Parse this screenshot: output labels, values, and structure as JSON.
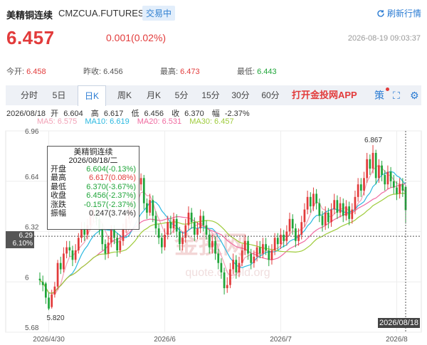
{
  "header": {
    "title_cn": "美精铜连续",
    "code": "CMZCUA.FUTURES",
    "badge": "交易中",
    "refresh_label": "刷新行情"
  },
  "quote": {
    "price": "6.457",
    "change": "0.001(0.02%)",
    "datetime": "2026-08-19 09:03:37"
  },
  "stats": [
    {
      "label": "今开:",
      "value": "6.458",
      "color": "red"
    },
    {
      "label": "昨收:",
      "value": "6.456",
      "color": "neutral"
    },
    {
      "label": "最高:",
      "value": "6.473",
      "color": "red"
    },
    {
      "label": "最低:",
      "value": "6.443",
      "color": "green"
    }
  ],
  "tabs": [
    "分时",
    "5日",
    "日K",
    "周K",
    "月K",
    "5分",
    "15分",
    "30分",
    "60分"
  ],
  "active_tab": "日K",
  "app_link": "打开金投网APP",
  "toolbar_icons": [
    "strategy-icon",
    "fullscreen-icon",
    "settings-icon"
  ],
  "toolbar_glyphs": {
    "strategy": "策",
    "fullscreen": "⛶",
    "settings": "⚙"
  },
  "ohlc": {
    "date": "2026/08/18",
    "open_label": "开",
    "open": "6.604",
    "high_label": "高",
    "high": "6.617",
    "low_label": "低",
    "low": "6.456",
    "close_label": "收",
    "close": "6.370",
    "amp_label": "幅",
    "amp": "-2.37%"
  },
  "ma": [
    {
      "label": "MA5: 6.575",
      "color": "#f2a1b6"
    },
    {
      "label": "MA10: 6.619",
      "color": "#2ab8e0"
    },
    {
      "label": "MA20: 6.531",
      "color": "#f06aa0"
    },
    {
      "label": "MA30: 6.457",
      "color": "#9ecb3a"
    }
  ],
  "tooltip": {
    "title": "美精铜连续",
    "date": "2026/08/18/二",
    "rows": [
      {
        "k": "开盘",
        "v": "6.604(-0.13%)",
        "c": "green"
      },
      {
        "k": "最高",
        "v": "6.617(0.08%)",
        "c": "red"
      },
      {
        "k": "最低",
        "v": "6.370(-3.67%)",
        "c": "green"
      },
      {
        "k": "收盘",
        "v": "6.456(-2.37%)",
        "c": "green"
      },
      {
        "k": "涨跌",
        "v": "-0.157(-2.37%)",
        "c": "green"
      },
      {
        "k": "振幅",
        "v": "0.247(3.74%)",
        "c": "neutral"
      }
    ]
  },
  "crosshair": {
    "price": "6.29",
    "pct": "6.10%",
    "date": "2026/08/18"
  },
  "watermark": {
    "cn": "金投网",
    "en": "quote.cngold.org"
  },
  "colors": {
    "up": "#e23b3b",
    "down": "#1fa539",
    "accent": "#2b7cd3"
  },
  "chart_data": {
    "type": "candlestick",
    "y_ticks": [
      6.96,
      6.64,
      6.32,
      6.0,
      5.68
    ],
    "y_tick_labels": [
      "6.96",
      "6.64",
      "6.32",
      "6",
      "5.68"
    ],
    "ylim": [
      5.68,
      6.96
    ],
    "x_tick_labels": [
      "2026/4/30",
      "2026/6",
      "2026/7",
      "2026/8"
    ],
    "x_tick_index": [
      3,
      42,
      81,
      120
    ],
    "max_label": "6.867",
    "min_label": "5.820",
    "grid": true,
    "candles": [
      [
        6.02,
        6.01,
        6.06,
        5.98
      ],
      [
        6.0,
        5.98,
        6.04,
        5.94
      ],
      [
        5.99,
        5.9,
        6.0,
        5.86
      ],
      [
        5.9,
        5.83,
        5.93,
        5.82
      ],
      [
        5.84,
        5.92,
        5.95,
        5.83
      ],
      [
        5.92,
        5.97,
        6.0,
        5.9
      ],
      [
        5.97,
        6.12,
        6.14,
        5.95
      ],
      [
        6.12,
        6.08,
        6.16,
        6.05
      ],
      [
        6.08,
        6.18,
        6.22,
        6.06
      ],
      [
        6.18,
        6.22,
        6.26,
        6.15
      ],
      [
        6.22,
        6.2,
        6.26,
        6.16
      ],
      [
        6.2,
        6.14,
        6.23,
        6.1
      ],
      [
        6.14,
        6.2,
        6.24,
        6.12
      ],
      [
        6.2,
        6.28,
        6.31,
        6.18
      ],
      [
        6.28,
        6.34,
        6.38,
        6.25
      ],
      [
        6.34,
        6.3,
        6.38,
        6.26
      ],
      [
        6.3,
        6.36,
        6.4,
        6.27
      ],
      [
        6.36,
        6.42,
        6.46,
        6.33
      ],
      [
        6.42,
        6.46,
        6.5,
        6.38
      ],
      [
        6.46,
        6.4,
        6.49,
        6.36
      ],
      [
        6.4,
        6.34,
        6.43,
        6.3
      ],
      [
        6.34,
        6.24,
        6.37,
        6.2
      ],
      [
        6.24,
        6.18,
        6.27,
        6.14
      ],
      [
        6.18,
        6.25,
        6.29,
        6.15
      ],
      [
        6.25,
        6.33,
        6.36,
        6.22
      ],
      [
        6.33,
        6.28,
        6.36,
        6.24
      ],
      [
        6.28,
        6.2,
        6.31,
        6.16
      ],
      [
        6.2,
        6.26,
        6.3,
        6.18
      ],
      [
        6.26,
        6.34,
        6.37,
        6.23
      ],
      [
        6.34,
        6.4,
        6.44,
        6.31
      ],
      [
        6.4,
        6.48,
        6.52,
        6.37
      ],
      [
        6.48,
        6.56,
        6.6,
        6.45
      ],
      [
        6.56,
        6.52,
        6.6,
        6.48
      ],
      [
        6.52,
        6.62,
        6.66,
        6.5
      ],
      [
        6.62,
        6.66,
        6.69,
        6.58
      ],
      [
        6.66,
        6.5,
        6.68,
        6.46
      ],
      [
        6.5,
        6.44,
        6.53,
        6.4
      ],
      [
        6.44,
        6.52,
        6.56,
        6.42
      ],
      [
        6.52,
        6.42,
        6.55,
        6.38
      ],
      [
        6.42,
        6.34,
        6.45,
        6.3
      ],
      [
        6.34,
        6.28,
        6.37,
        6.24
      ],
      [
        6.28,
        6.22,
        6.31,
        6.18
      ],
      [
        6.22,
        6.3,
        6.34,
        6.2
      ],
      [
        6.3,
        6.38,
        6.42,
        6.27
      ],
      [
        6.38,
        6.34,
        6.42,
        6.3
      ],
      [
        6.34,
        6.4,
        6.44,
        6.31
      ],
      [
        6.4,
        6.32,
        6.43,
        6.28
      ],
      [
        6.32,
        6.24,
        6.35,
        6.2
      ],
      [
        6.24,
        6.28,
        6.32,
        6.2
      ],
      [
        6.28,
        6.36,
        6.4,
        6.25
      ],
      [
        6.36,
        6.44,
        6.48,
        6.33
      ],
      [
        6.44,
        6.38,
        6.47,
        6.34
      ],
      [
        6.38,
        6.3,
        6.41,
        6.26
      ],
      [
        6.3,
        6.34,
        6.38,
        6.27
      ],
      [
        6.34,
        6.42,
        6.46,
        6.31
      ],
      [
        6.42,
        6.36,
        6.45,
        6.32
      ],
      [
        6.36,
        6.3,
        6.39,
        6.27
      ],
      [
        6.3,
        6.22,
        6.33,
        6.18
      ],
      [
        6.22,
        6.26,
        6.3,
        6.18
      ],
      [
        6.26,
        6.18,
        6.29,
        6.14
      ],
      [
        6.18,
        6.12,
        6.21,
        6.08
      ],
      [
        6.12,
        6.06,
        6.15,
        6.02
      ],
      [
        6.06,
        5.96,
        6.09,
        5.92
      ],
      [
        5.96,
        5.98,
        6.03,
        5.93
      ],
      [
        5.98,
        6.08,
        6.12,
        5.96
      ],
      [
        6.08,
        6.14,
        6.18,
        6.05
      ],
      [
        6.14,
        6.06,
        6.17,
        6.02
      ],
      [
        6.06,
        6.12,
        6.16,
        6.03
      ],
      [
        6.12,
        6.2,
        6.24,
        6.1
      ],
      [
        6.2,
        6.26,
        6.3,
        6.17
      ],
      [
        6.26,
        6.18,
        6.29,
        6.14
      ],
      [
        6.18,
        6.12,
        6.21,
        6.08
      ],
      [
        6.12,
        6.16,
        6.2,
        6.09
      ],
      [
        6.16,
        6.22,
        6.26,
        6.13
      ],
      [
        6.22,
        6.18,
        6.26,
        6.15
      ],
      [
        6.18,
        6.24,
        6.28,
        6.15
      ],
      [
        6.24,
        6.2,
        6.28,
        6.17
      ],
      [
        6.2,
        6.14,
        6.23,
        6.1
      ],
      [
        6.14,
        6.2,
        6.24,
        6.11
      ],
      [
        6.2,
        6.28,
        6.31,
        6.17
      ],
      [
        6.28,
        6.24,
        6.31,
        6.2
      ],
      [
        6.24,
        6.3,
        6.34,
        6.21
      ],
      [
        6.3,
        6.26,
        6.33,
        6.22
      ],
      [
        6.26,
        6.32,
        6.36,
        6.23
      ],
      [
        6.32,
        6.4,
        6.44,
        6.29
      ],
      [
        6.4,
        6.34,
        6.43,
        6.3
      ],
      [
        6.34,
        6.26,
        6.37,
        6.22
      ],
      [
        6.26,
        6.3,
        6.34,
        6.23
      ],
      [
        6.3,
        6.38,
        6.42,
        6.27
      ],
      [
        6.38,
        6.46,
        6.5,
        6.35
      ],
      [
        6.46,
        6.54,
        6.58,
        6.43
      ],
      [
        6.54,
        6.48,
        6.57,
        6.44
      ],
      [
        6.48,
        6.56,
        6.6,
        6.45
      ],
      [
        6.56,
        6.5,
        6.59,
        6.46
      ],
      [
        6.5,
        6.42,
        6.53,
        6.38
      ],
      [
        6.42,
        6.36,
        6.45,
        6.32
      ],
      [
        6.36,
        6.44,
        6.48,
        6.33
      ],
      [
        6.44,
        6.38,
        6.47,
        6.34
      ],
      [
        6.38,
        6.46,
        6.5,
        6.35
      ],
      [
        6.46,
        6.52,
        6.56,
        6.43
      ],
      [
        6.52,
        6.44,
        6.55,
        6.4
      ],
      [
        6.44,
        6.5,
        6.54,
        6.41
      ],
      [
        6.5,
        6.42,
        6.53,
        6.38
      ],
      [
        6.42,
        6.48,
        6.52,
        6.39
      ],
      [
        6.48,
        6.4,
        6.51,
        6.36
      ],
      [
        6.4,
        6.46,
        6.5,
        6.37
      ],
      [
        6.46,
        6.54,
        6.58,
        6.43
      ],
      [
        6.54,
        6.62,
        6.66,
        6.51
      ],
      [
        6.62,
        6.58,
        6.66,
        6.54
      ],
      [
        6.58,
        6.66,
        6.7,
        6.55
      ],
      [
        6.66,
        6.78,
        6.82,
        6.63
      ],
      [
        6.78,
        6.72,
        6.81,
        6.68
      ],
      [
        6.72,
        6.82,
        6.87,
        6.69
      ],
      [
        6.82,
        6.66,
        6.84,
        6.62
      ],
      [
        6.66,
        6.74,
        6.78,
        6.63
      ],
      [
        6.74,
        6.68,
        6.77,
        6.64
      ],
      [
        6.68,
        6.62,
        6.71,
        6.58
      ],
      [
        6.62,
        6.7,
        6.74,
        6.59
      ],
      [
        6.7,
        6.64,
        6.73,
        6.6
      ],
      [
        6.64,
        6.6,
        6.68,
        6.56
      ],
      [
        6.6,
        6.56,
        6.64,
        6.52
      ],
      [
        6.56,
        6.62,
        6.66,
        6.53
      ],
      [
        6.62,
        6.58,
        6.66,
        6.54
      ],
      [
        6.604,
        6.456,
        6.617,
        6.37
      ]
    ]
  }
}
